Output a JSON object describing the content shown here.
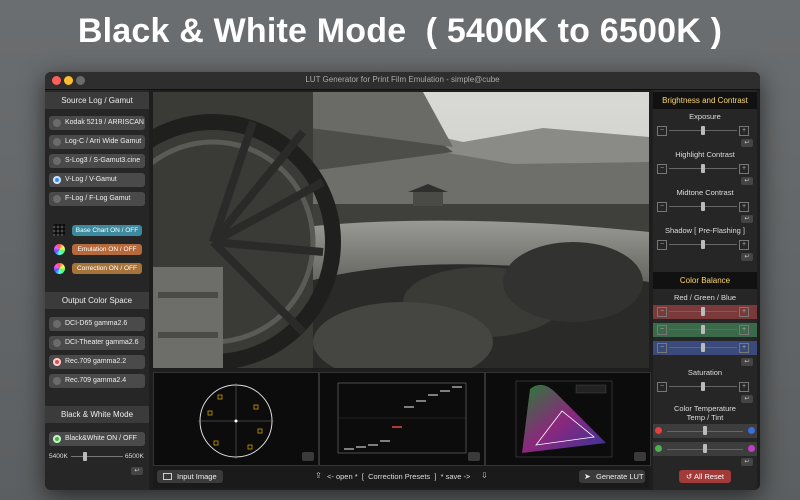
{
  "headline": "Black & White Mode  ( 5400K to 6500K )",
  "window": {
    "title": "LUT Generator for Print Film Emulation - simple@cube"
  },
  "colors": {
    "close": "#ff5f57",
    "minimize": "#febc2e",
    "zoom": "#6b6b6b",
    "accent_gold": "#ffd86a"
  },
  "left": {
    "source_title": "Source Log / Gamut",
    "source_items": [
      {
        "label": "Kodak 5219 / ARRISCAN",
        "selected": false
      },
      {
        "label": "Log-C / Arri Wide Gamut",
        "selected": false
      },
      {
        "label": "S-Log3 / S-Gamut3.cine",
        "selected": false
      },
      {
        "label": "V-Log / V-Gamut",
        "selected": true
      },
      {
        "label": "F-Log / F-Log Gamut",
        "selected": false
      }
    ],
    "toggles": [
      {
        "label": "Base Chart ON / OFF",
        "color": "#3b8aa0",
        "icon": "chart-grid-icon"
      },
      {
        "label": "Emulation ON / OFF",
        "color": "#b46a3a",
        "icon": "color-wheel-icon"
      },
      {
        "label": "Correction ON / OFF",
        "color": "#a6743a",
        "icon": "color-wheel-icon"
      }
    ],
    "output_title": "Output Color Space",
    "output_items": [
      {
        "label": "DCI-D65 gamma2.6",
        "selected": false
      },
      {
        "label": "DCI-Theater gamma2.6",
        "selected": false
      },
      {
        "label": "Rec.709 gamma2.2",
        "selected": true
      },
      {
        "label": "Rec.709 gamma2.4",
        "selected": false
      }
    ],
    "bw_title": "Black & White Mode",
    "bw_toggle": {
      "label": "Black&White ON / OFF",
      "enabled": true
    },
    "bw_min": "5400K",
    "bw_max": "6500K",
    "bw_level": 0.25
  },
  "right": {
    "bc_title": "Brightness and Contrast",
    "bc_rows": [
      {
        "label": "Exposure",
        "level": 0.5
      },
      {
        "label": "Highlight Contrast",
        "level": 0.5
      },
      {
        "label": "Midtone Contrast",
        "level": 0.5
      },
      {
        "label": "Shadow [ Pre-Flashing ]",
        "level": 0.5
      }
    ],
    "cb_title": "Color Balance",
    "rgb_label": "Red / Green / Blue",
    "rgb_tracks": [
      {
        "name": "red",
        "color": "#7a3a3a",
        "level": 0.5
      },
      {
        "name": "green",
        "color": "#3a6a4a",
        "level": 0.5
      },
      {
        "name": "blue",
        "color": "#3a4a7a",
        "level": 0.5
      }
    ],
    "saturation_label": "Saturation",
    "saturation_level": 0.5,
    "temp_label": "Color Temperature\nTemp / Tint",
    "temp_level": 0.5,
    "tint_level": 0.5,
    "all_reset": "All Reset"
  },
  "bottom": {
    "input_image": "Input Image",
    "presets": "<- open *  [  Correction Presets  ]  * save ->",
    "generate": "Generate LUT"
  }
}
